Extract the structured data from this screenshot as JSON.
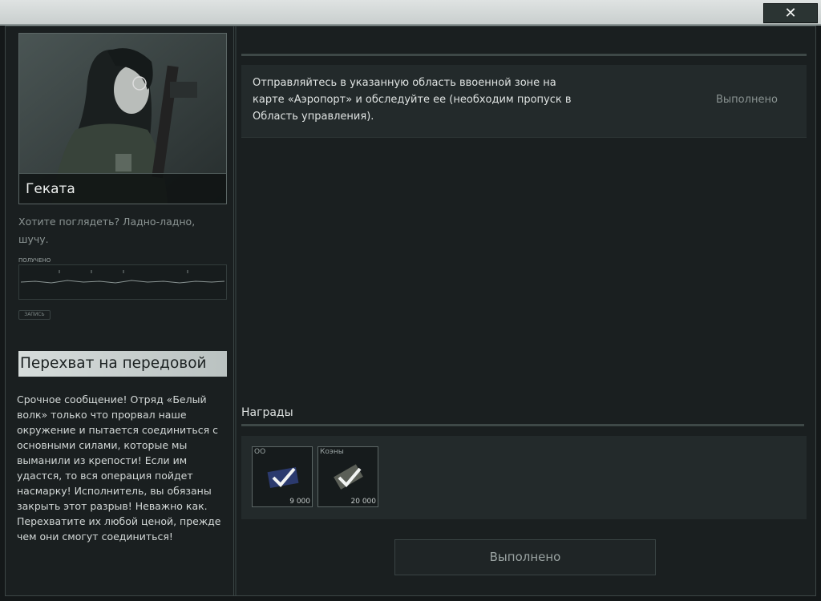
{
  "window": {
    "close_label": "✕"
  },
  "trader": {
    "name": "Геката",
    "quote": "Хотите поглядеть? Ладно-ладно, шучу.",
    "audio_label": "ПОЛУЧЕНО",
    "audio_small_label": "ЗАПИСЬ"
  },
  "quest": {
    "title": "Перехват на передовой",
    "description": "Срочное сообщение! Отряд «Белый волк» только что прорвал наше окружение и пытается соединиться с основными силами, которые мы выманили из крепости! Если им удастся, то вся операция пойдет насмарку! Исполнитель, вы обязаны закрыть этот разрыв! Неважно как. Перехватите их любой ценой, прежде чем они смогут соединиться!"
  },
  "objectives": [
    {
      "text": "Отправляйтесь в указанную область ввоенной зоне на карте «Аэропорт» и обследуйте ее (необходим пропуск в Область управления).",
      "status": "Выполнено"
    }
  ],
  "rewards": {
    "label": "Награды",
    "items": [
      {
        "name": "ОО",
        "count": "9 000",
        "icon": "exp-token-icon",
        "color": "#2b3a6e"
      },
      {
        "name": "Коэны",
        "count": "20 000",
        "icon": "coins-icon",
        "color": "#5b5f57"
      }
    ]
  },
  "actions": {
    "complete_label": "Выполнено"
  },
  "colors": {
    "background": "#1a1f20",
    "panel": "#232a2b",
    "title_bar": "#d6dcdb",
    "check": "#f2f4f3"
  }
}
